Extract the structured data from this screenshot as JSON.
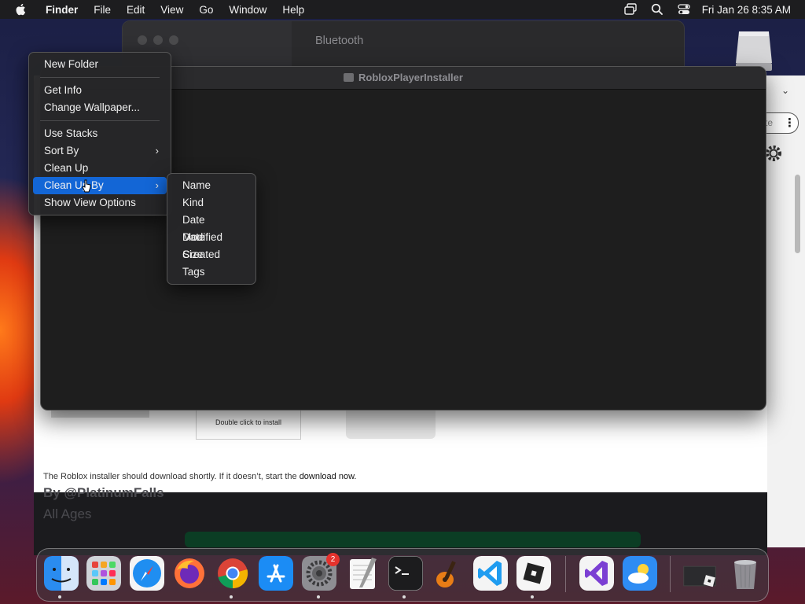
{
  "menubar": {
    "app": "Finder",
    "items": [
      "File",
      "Edit",
      "View",
      "Go",
      "Window",
      "Help"
    ],
    "clock": "Fri Jan 26  8:35 AM"
  },
  "settings_window": {
    "title": "Bluetooth"
  },
  "finder_window": {
    "title": "RobloxPlayerInstaller"
  },
  "context_menu": {
    "items": [
      {
        "label": "New Folder"
      },
      {
        "label": "Get Info"
      },
      {
        "label": "Change Wallpaper..."
      },
      {
        "label": "Use Stacks"
      },
      {
        "label": "Sort By",
        "submenu": true
      },
      {
        "label": "Clean Up"
      },
      {
        "label": "Clean Up By",
        "submenu": true,
        "active": true
      },
      {
        "label": "Show View Options"
      }
    ]
  },
  "submenu": {
    "items": [
      "Name",
      "Kind",
      "Date Modified",
      "Date Created",
      "Size",
      "Tags"
    ]
  },
  "browser": {
    "download_text": "The Roblox installer should download shortly. If it doesn’t, start the ",
    "download_link": "download now.",
    "install_caption": "Double click to install",
    "ghost_author": "By @PlatinumFalls",
    "ghost_age": "All Ages",
    "pill_text": "te"
  },
  "dock": {
    "items": [
      "Finder",
      "Launchpad",
      "Safari",
      "Firefox",
      "Chrome",
      "App Store",
      "System Settings",
      "TextEdit",
      "Terminal",
      "GarageBand",
      "Visual Studio Code",
      "Roblox",
      "Visual Studio",
      "Weather",
      "Downloads",
      "Trash"
    ],
    "settings_badge": "2"
  },
  "colors": {
    "accent": "#1366d6",
    "menu_bg": "#262628"
  }
}
